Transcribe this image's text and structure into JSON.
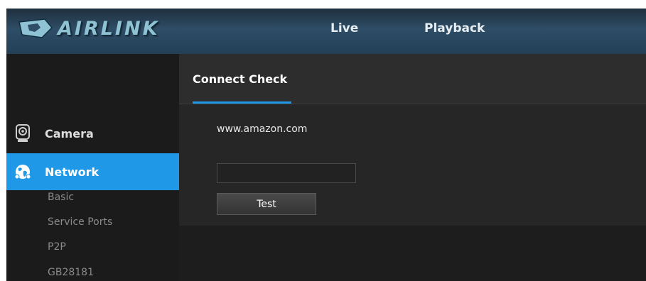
{
  "header": {
    "logo_text": "AIRLINK",
    "nav": [
      {
        "label": "Live"
      },
      {
        "label": "Playback"
      }
    ]
  },
  "sidebar": {
    "items": [
      {
        "label": "Camera",
        "icon": "camera-icon",
        "active": false
      },
      {
        "label": "Network",
        "icon": "network-globe-icon",
        "active": true
      }
    ],
    "subitems": [
      {
        "label": "Basic"
      },
      {
        "label": "Service Ports"
      },
      {
        "label": "P2P"
      },
      {
        "label": "GB28181"
      }
    ]
  },
  "panel": {
    "title": "Connect Check",
    "url": "www.amazon.com",
    "result_value": "",
    "test_label": "Test"
  },
  "colors": {
    "accent": "#1f98e8",
    "header_top": "#1f2f3d",
    "header_mid": "#2e4d66",
    "logo": "#8fc3d4",
    "panel_bg": "#262626",
    "sidebar_bg": "#1b1b1b"
  }
}
